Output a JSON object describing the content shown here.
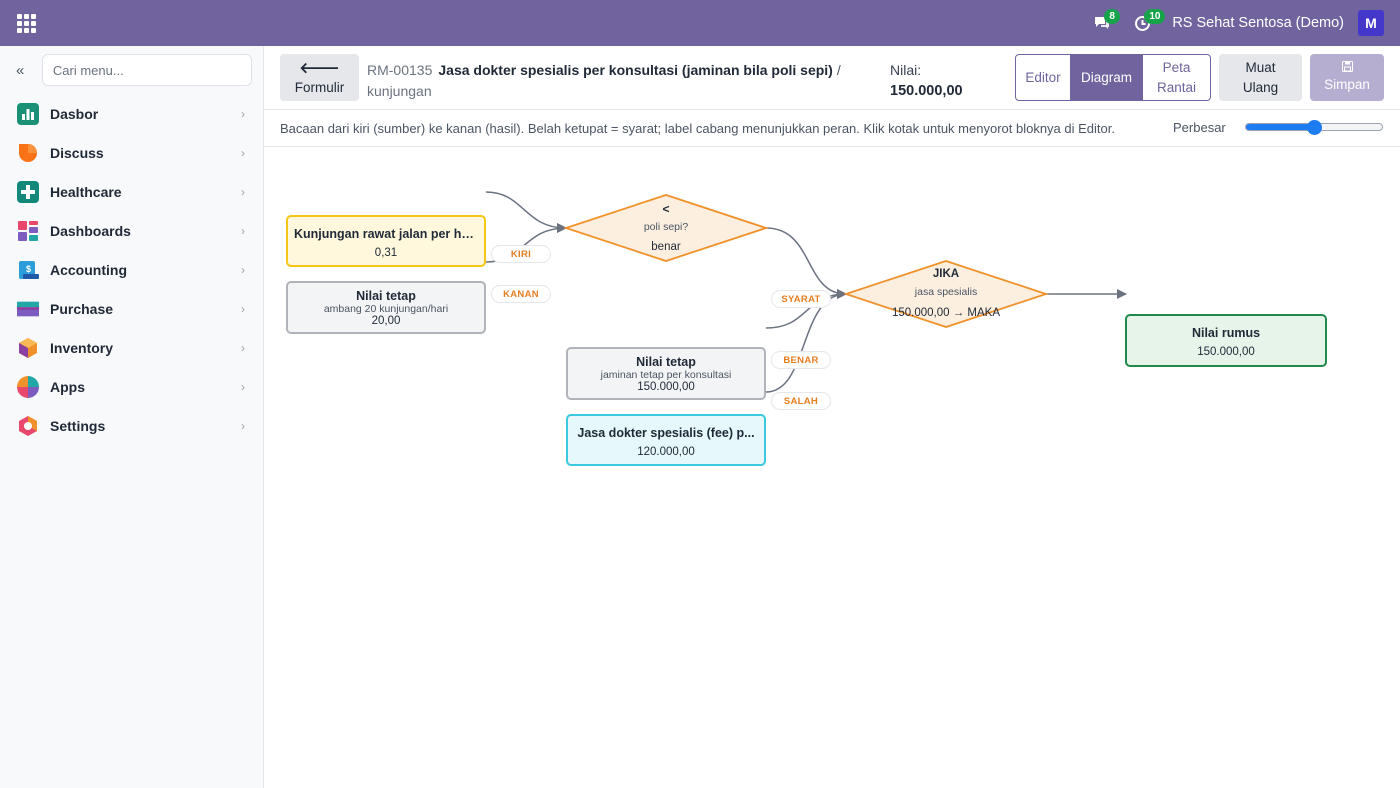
{
  "topbar": {
    "chat_badge": "8",
    "activity_badge": "10",
    "company": "RS Sehat Sentosa (Demo)",
    "avatar_letter": "M"
  },
  "sidebar": {
    "search_placeholder": "Cari menu...",
    "items": [
      {
        "label": "Dasbor",
        "icon": "bar-chart-icon"
      },
      {
        "label": "Discuss",
        "icon": "discuss-icon"
      },
      {
        "label": "Healthcare",
        "icon": "healthcare-cross-icon"
      },
      {
        "label": "Dashboards",
        "icon": "dashboards-icon"
      },
      {
        "label": "Accounting",
        "icon": "accounting-icon"
      },
      {
        "label": "Purchase",
        "icon": "purchase-icon"
      },
      {
        "label": "Inventory",
        "icon": "inventory-icon"
      },
      {
        "label": "Apps",
        "icon": "apps-icon"
      },
      {
        "label": "Settings",
        "icon": "settings-icon"
      }
    ]
  },
  "control": {
    "back_label": "Formulir",
    "record_code": "RM-00135",
    "record_title": "Jasa dokter spesialis per konsultasi (jaminan bila poli sepi)",
    "separator": "/",
    "record_sub": "kunjungan",
    "nilai_label": "Nilai:",
    "nilai_value": "150.000,00",
    "views": {
      "editor": "Editor",
      "diagram": "Diagram",
      "peta": "Peta Rantai"
    },
    "reload": "Muat Ulang",
    "save": "Simpan"
  },
  "hint": {
    "text": "Bacaan dari kiri (sumber) ke kanan (hasil). Belah ketupat = syarat; label cabang menunjukkan peran. Klik kotak untuk menyorot bloknya di Editor.",
    "zoom_label": "Perbesar",
    "zoom_level": 0.5
  },
  "diagram": {
    "node_visits": {
      "title": "Kunjungan rawat jalan per har...",
      "value": "0,31"
    },
    "node_fixed1": {
      "title": "Nilai tetap",
      "sub": "ambang 20 kunjungan/hari",
      "value": "20,00"
    },
    "node_compare": {
      "op": "<",
      "sub": "poli sepi?",
      "value": "benar"
    },
    "node_fixed2": {
      "title": "Nilai tetap",
      "sub": "jaminan tetap per konsultasi",
      "value": "150.000,00"
    },
    "node_fee": {
      "title": "Jasa dokter spesialis (fee) p...",
      "value": "120.000,00"
    },
    "node_if": {
      "op": "JIKA",
      "sub": "jasa spesialis",
      "value": "150.000,00 → MAKA"
    },
    "node_result": {
      "title": "Nilai rumus",
      "value": "150.000,00"
    },
    "edges": {
      "kiri": "KIRI",
      "kanan": "KANAN",
      "syarat": "SYARAT",
      "benar": "BENAR",
      "salah": "SALAH"
    }
  },
  "colors": {
    "brand": "#71639e",
    "source_node": "#f5c518",
    "fixed_node": "#b0b4ba",
    "condition": "#f0922b",
    "field_node": "#3cc8e0",
    "result_node": "#1f8a4c"
  }
}
